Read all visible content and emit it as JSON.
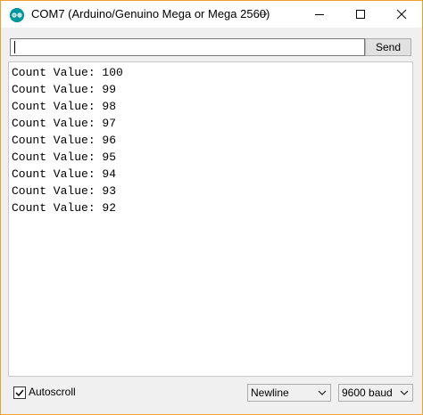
{
  "window": {
    "title": "COM7 (Arduino/Genuino Mega or Mega 2560)",
    "accent_color": "#00979c",
    "border_color": "#f0a030"
  },
  "input": {
    "value": "",
    "send_label": "Send"
  },
  "output": {
    "lines": [
      "Count Value: 100",
      "Count Value: 99",
      "Count Value: 98",
      "Count Value: 97",
      "Count Value: 96",
      "Count Value: 95",
      "Count Value: 94",
      "Count Value: 93",
      "Count Value: 92"
    ]
  },
  "footer": {
    "autoscroll_label": "Autoscroll",
    "autoscroll_checked": true,
    "line_ending": "Newline",
    "baud_rate": "9600 baud"
  }
}
